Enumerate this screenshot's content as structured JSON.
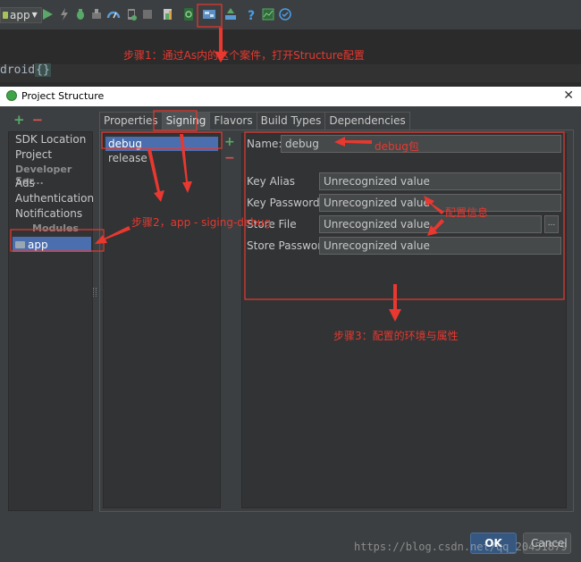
{
  "toolbar": {
    "run_config": "app",
    "icons": [
      "run-icon",
      "debug-lightning-icon",
      "bug-icon",
      "attach-icon",
      "profile-icon",
      "device-icon",
      "stop-icon",
      "sync-icon",
      "gradle-icon",
      "project-structure-icon",
      "sdk-manager-icon",
      "help-icon",
      "monitor-icon",
      "check-icon"
    ]
  },
  "editor": {
    "code_prefix": "droid",
    "brace": "{}"
  },
  "annotations": {
    "step1": "步骤1：通过As内的这个案件，打开Structure配置",
    "step2": "步骤2，app - siging-debug",
    "step3": "步骤3：配置的环境与属性",
    "debug_pkg": "debug包",
    "config_info": "配置信息"
  },
  "dialog": {
    "title": "Project Structure",
    "close_symbol": "✕",
    "left_panel": {
      "items": [
        "SDK Location",
        "Project"
      ],
      "dev_services_header": "Developer Ser...",
      "services": [
        "Ads",
        "Authentication",
        "Notifications"
      ],
      "modules_header": "Modules",
      "selected_module": "app"
    },
    "tabs": [
      {
        "label": "Properties",
        "active": false
      },
      {
        "label": "Signing",
        "active": true
      },
      {
        "label": "Flavors",
        "active": false
      },
      {
        "label": "Build Types",
        "active": false
      },
      {
        "label": "Dependencies",
        "active": false
      }
    ],
    "configs": [
      "debug",
      "release"
    ],
    "form": {
      "name_label": "Name:",
      "name_value": "debug",
      "key_alias_label": "Key Alias",
      "key_alias_value": "Unrecognized value",
      "key_password_label": "Key Password",
      "key_password_value": "Unrecognized value",
      "store_file_label": "Store File",
      "store_file_value": "Unrecognized value",
      "browse_label": "...",
      "store_password_label": "Store Password",
      "store_password_value": "Unrecognized value"
    },
    "ok_label": "OK",
    "cancel_label": "Cancel"
  },
  "watermark": "https://blog.csdn.net/qq_20451879",
  "colors": {
    "annotation_red": "#e8382f",
    "selection_blue": "#4b6eaf",
    "add_green": "#59a869"
  }
}
